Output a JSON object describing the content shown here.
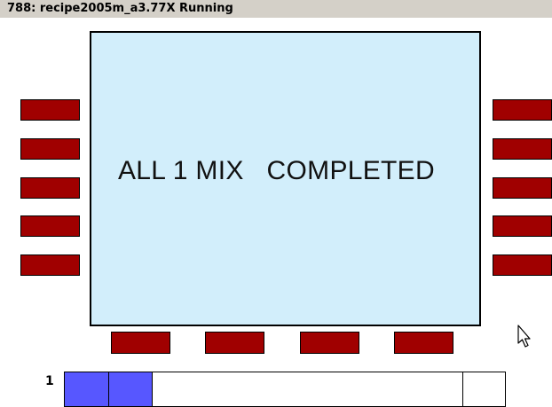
{
  "window": {
    "title": "788: recipe2005m_a3.77X Running"
  },
  "status": {
    "message": "ALL 1 MIX   COMPLETED"
  },
  "pads": {
    "color": "#a00000",
    "left_count": 5,
    "right_count": 5,
    "bottom_count": 4
  },
  "panel": {
    "background": "#d2eefb"
  },
  "progress": {
    "row_label": "1",
    "filled_color": "#5757ff",
    "filled_slots": 2
  }
}
